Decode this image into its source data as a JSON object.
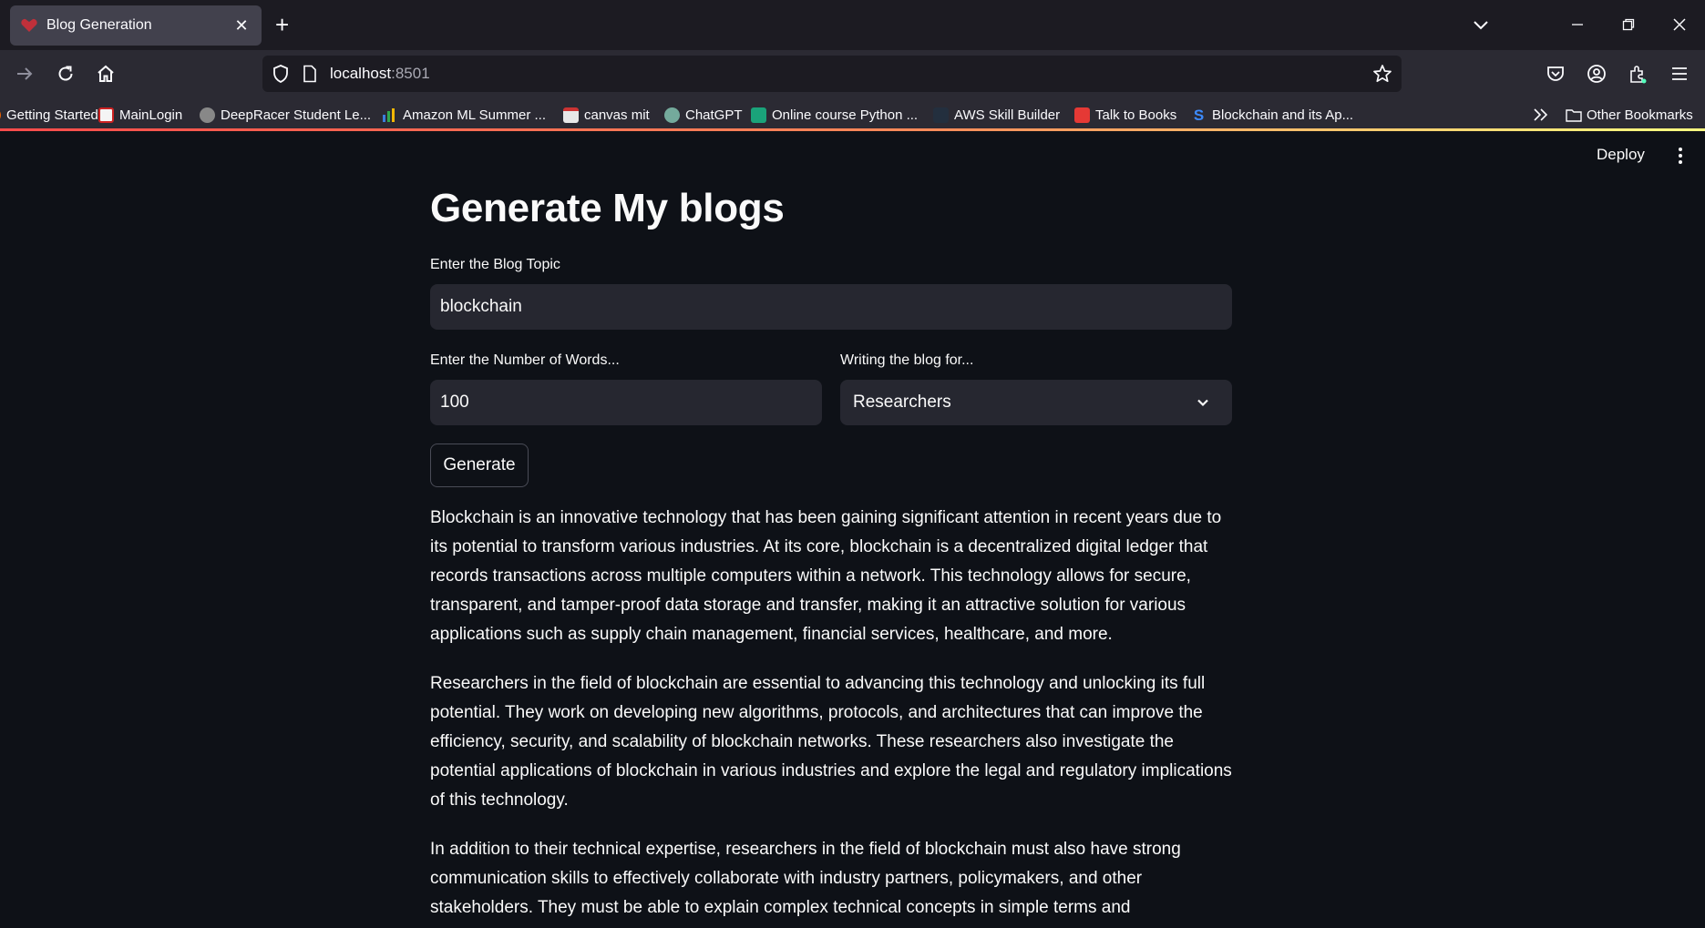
{
  "browser": {
    "tab_title": "Blog Generation",
    "url_host": "localhost",
    "url_port": ":8501",
    "bookmarks": [
      {
        "label": "Getting Started",
        "icon": "firefox-icon"
      },
      {
        "label": "MainLogin",
        "icon": "site-icon"
      },
      {
        "label": "DeepRacer Student Le...",
        "icon": "deepracer-icon"
      },
      {
        "label": "Amazon ML Summer ...",
        "icon": "chart-icon"
      },
      {
        "label": "canvas mit",
        "icon": "canvas-icon"
      },
      {
        "label": "ChatGPT",
        "icon": "chatgpt-icon"
      },
      {
        "label": "Online course Python ...",
        "icon": "graduation-icon"
      },
      {
        "label": "AWS Skill Builder",
        "icon": "aws-icon"
      },
      {
        "label": "Talk to Books",
        "icon": "book-icon"
      },
      {
        "label": "Blockchain and its Ap...",
        "icon": "s-icon"
      }
    ],
    "other_bookmarks": "Other Bookmarks"
  },
  "app": {
    "deploy_label": "Deploy",
    "title": "Generate My blogs",
    "topic_label": "Enter the Blog Topic",
    "topic_value": "blockchain",
    "words_label": "Enter the Number of Words...",
    "words_value": "100",
    "audience_label": "Writing the blog for...",
    "audience_value": "Researchers",
    "generate_label": "Generate",
    "paragraphs": [
      "Blockchain is an innovative technology that has been gaining significant attention in recent years due to its potential to transform various industries. At its core, blockchain is a decentralized digital ledger that records transactions across multiple computers within a network. This technology allows for secure, transparent, and tamper-proof data storage and transfer, making it an attractive solution for various applications such as supply chain management, financial services, healthcare, and more.",
      "Researchers in the field of blockchain are essential to advancing this technology and unlocking its full potential. They work on developing new algorithms, protocols, and architectures that can improve the efficiency, security, and scalability of blockchain networks. These researchers also investigate the potential applications of blockchain in various industries and explore the legal and regulatory implications of this technology.",
      "In addition to their technical expertise, researchers in the field of blockchain must also have strong communication skills to effectively collaborate with industry partners, policymakers, and other stakeholders. They must be able to explain complex technical concepts in simple terms and communicate"
    ]
  },
  "colors": {
    "app_bg": "#0e1117",
    "input_bg": "#262730",
    "accent": "#ff4b4b"
  }
}
